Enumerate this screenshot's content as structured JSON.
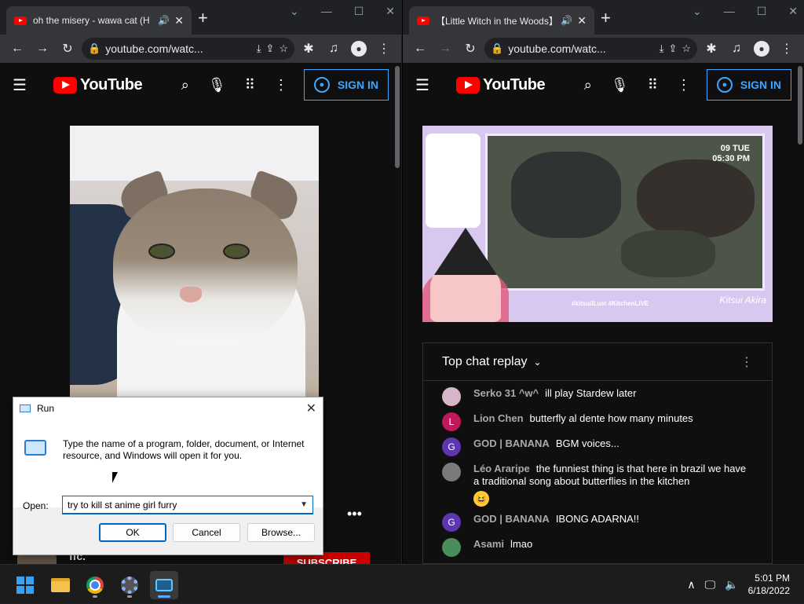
{
  "left": {
    "tab_title": "oh the misery - wawa cat (H",
    "url": "youtube.com/watc...",
    "yt_logo": "YouTube",
    "sign_in": "SIGN IN",
    "channel_name": "ffc.",
    "subscribe": "SUBSCRIBE"
  },
  "right": {
    "tab_title": "【Little Witch in the Woods】",
    "url": "youtube.com/watc...",
    "yt_logo": "YouTube",
    "sign_in": "SIGN IN",
    "stream": {
      "date": "09 TUE",
      "time": "05:30 PM",
      "tags": "#kitsuilLust #KitchenLIVE",
      "signature": "Kitsui Akira"
    },
    "chat_header": "Top chat replay",
    "chat_messages": [
      {
        "author": "Serko 31 ^w^",
        "text": "ill play Stardew later",
        "avatar_letter": "",
        "avatar_color": "#d8b4c8"
      },
      {
        "author": "Lion Chen",
        "text": "butterfly al dente how many minutes",
        "avatar_letter": "L",
        "avatar_color": "#c2185b"
      },
      {
        "author": "GOD | BANANA",
        "text": "BGM voices...",
        "avatar_letter": "G",
        "avatar_color": "#5e35b1"
      },
      {
        "author": "Léo Araripe",
        "text": "the funniest thing is that here in brazil we have a traditional song about butterflies in the kitchen",
        "avatar_letter": "",
        "avatar_color": "#7a7a7a"
      },
      {
        "author": "GOD | BANANA",
        "text": "IBONG ADARNA!!",
        "avatar_letter": "G",
        "avatar_color": "#5e35b1"
      },
      {
        "author": "Asami",
        "text": "lmao",
        "avatar_letter": "",
        "avatar_color": "#4a8c5a"
      }
    ]
  },
  "run_dialog": {
    "title": "Run",
    "description": "Type the name of a program, folder, document, or Internet resource, and Windows will open it for you.",
    "open_label": "Open:",
    "input_value": "try to kill st anime girl furry",
    "ok": "OK",
    "cancel": "Cancel",
    "browse": "Browse..."
  },
  "taskbar": {
    "time": "5:01 PM",
    "date": "6/18/2022"
  }
}
